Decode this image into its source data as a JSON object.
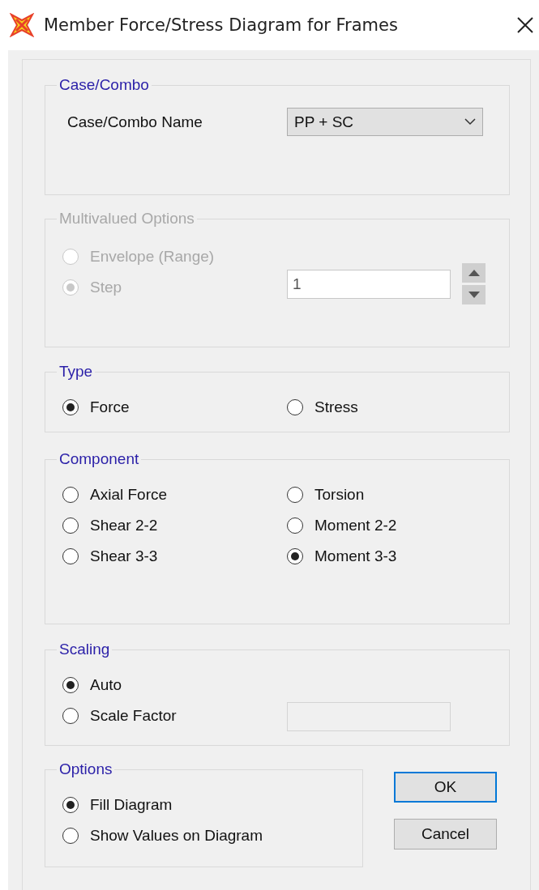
{
  "window": {
    "title": "Member Force/Stress Diagram for Frames"
  },
  "case_combo": {
    "title": "Case/Combo",
    "label": "Case/Combo Name",
    "value": "PP + SC"
  },
  "multivalued_options": {
    "title": "Multivalued Options",
    "disabled": true,
    "options": [
      {
        "label": "Envelope (Range)",
        "selected": false
      },
      {
        "label": "Step",
        "selected": true
      }
    ],
    "step_value": "1"
  },
  "type": {
    "title": "Type",
    "options": [
      {
        "label": "Force",
        "selected": true
      },
      {
        "label": "Stress",
        "selected": false
      }
    ]
  },
  "component": {
    "title": "Component",
    "options": [
      {
        "label": "Axial Force",
        "selected": false
      },
      {
        "label": "Torsion",
        "selected": false
      },
      {
        "label": "Shear 2-2",
        "selected": false
      },
      {
        "label": "Moment 2-2",
        "selected": false
      },
      {
        "label": "Shear 3-3",
        "selected": false
      },
      {
        "label": "Moment 3-3",
        "selected": true
      }
    ]
  },
  "scaling": {
    "title": "Scaling",
    "options": [
      {
        "label": "Auto",
        "selected": true
      },
      {
        "label": "Scale Factor",
        "selected": false
      }
    ]
  },
  "options": {
    "title": "Options",
    "options": [
      {
        "label": "Fill Diagram",
        "selected": true
      },
      {
        "label": "Show Values on Diagram",
        "selected": false
      }
    ]
  },
  "buttons": [
    {
      "label": "OK",
      "default": true
    },
    {
      "label": "Cancel",
      "default": false
    }
  ]
}
